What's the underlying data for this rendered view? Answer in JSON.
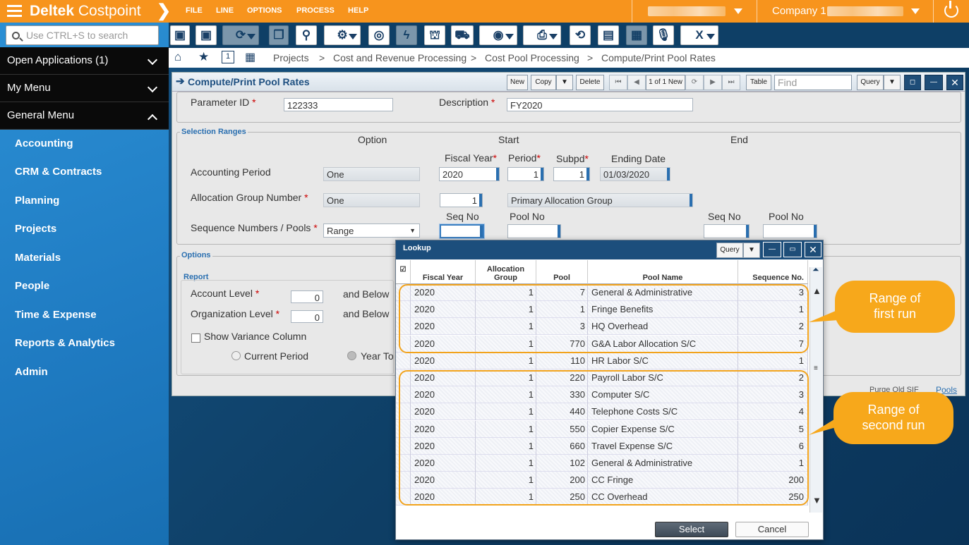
{
  "topbar": {
    "brand_bold": "Deltek",
    "brand_light": "Costpoint",
    "menus": [
      "FILE",
      "LINE",
      "OPTIONS",
      "PROCESS",
      "HELP"
    ],
    "company": "Company 1"
  },
  "sidebar": {
    "search_placeholder": "Use CTRL+S to search",
    "groups": [
      "Open Applications (1)",
      "My Menu",
      "General Menu"
    ],
    "items": [
      "Accounting",
      "CRM & Contracts",
      "Planning",
      "Projects",
      "Materials",
      "People",
      "Time & Expense",
      "Reports & Analytics",
      "Admin"
    ]
  },
  "breadcrumb": {
    "tab_number": "1",
    "path": [
      "Projects",
      ">",
      "Cost and Revenue Processing",
      ">",
      "Cost Pool Processing",
      ">",
      "Compute/Print Pool Rates"
    ]
  },
  "app": {
    "title": "Compute/Print Pool Rates",
    "buttons": {
      "new": "New",
      "copy": "Copy",
      "delete": "Delete",
      "record": "1 of 1 New",
      "table": "Table",
      "query": "Query"
    },
    "find_placeholder": "Find",
    "param_label": "Parameter ID",
    "param_value": "122333",
    "desc_label": "Description",
    "desc_value": "FY2020",
    "sel_ranges": "Selection Ranges",
    "option": "Option",
    "start": "Start",
    "end": "End",
    "fiscal_year": "Fiscal Year",
    "period": "Period",
    "subpd": "Subpd",
    "ending_date": "Ending Date",
    "acct_period": "Accounting Period",
    "acct_option": "One",
    "fy_value": "2020",
    "period_value": "1",
    "subpd_value": "1",
    "end_date_value": "01/03/2020",
    "alloc_group": "Allocation Group Number",
    "alloc_option": "One",
    "alloc_value": "1",
    "alloc_name": "Primary Allocation Group",
    "seq_no": "Seq No",
    "pool_no": "Pool No",
    "seq_label": "Sequence Numbers / Pools",
    "seq_option": "Range",
    "options_title": "Options",
    "report_title": "Report",
    "account_level": "Account Level",
    "account_value": "0",
    "and_below": "and Below",
    "org_level": "Organization Level",
    "org_value": "0",
    "show_variance": "Show Variance Column",
    "current_period": "Current Period",
    "year_to": "Year To D",
    "purge": "Purge Old SIF",
    "pools_link": "Pools"
  },
  "lookup": {
    "title": "Lookup",
    "query": "Query",
    "columns": [
      "Fiscal Year",
      "Allocation Group",
      "Pool",
      "Pool Name",
      "Sequence No."
    ],
    "rows": [
      [
        "2020",
        "1",
        "7",
        "General & Administrative",
        "3"
      ],
      [
        "2020",
        "1",
        "1",
        "Fringe Benefits",
        "1"
      ],
      [
        "2020",
        "1",
        "3",
        "HQ Overhead",
        "2"
      ],
      [
        "2020",
        "1",
        "770",
        "G&A Labor Allocation S/C",
        "7"
      ],
      [
        "2020",
        "1",
        "110",
        "HR Labor S/C",
        "1"
      ],
      [
        "2020",
        "1",
        "220",
        "Payroll Labor S/C",
        "2"
      ],
      [
        "2020",
        "1",
        "330",
        "Computer S/C",
        "3"
      ],
      [
        "2020",
        "1",
        "440",
        "Telephone Costs S/C",
        "4"
      ],
      [
        "2020",
        "1",
        "550",
        "Copier Expense S/C",
        "5"
      ],
      [
        "2020",
        "1",
        "660",
        "Travel Expense S/C",
        "6"
      ],
      [
        "2020",
        "1",
        "102",
        "General & Administrative",
        "1"
      ],
      [
        "2020",
        "1",
        "200",
        "CC Fringe",
        "200"
      ],
      [
        "2020",
        "1",
        "250",
        "CC Overhead",
        "250"
      ]
    ],
    "select": "Select",
    "cancel": "Cancel"
  },
  "callouts": {
    "first_line1": "Range of",
    "first_line2": "first run",
    "second_line1": "Range of",
    "second_line2": "second run"
  },
  "colors": {
    "accent": "#f7941d",
    "sidebar": "#1f7bc2",
    "header": "#1c4e7c",
    "callout": "#f7a81b"
  }
}
